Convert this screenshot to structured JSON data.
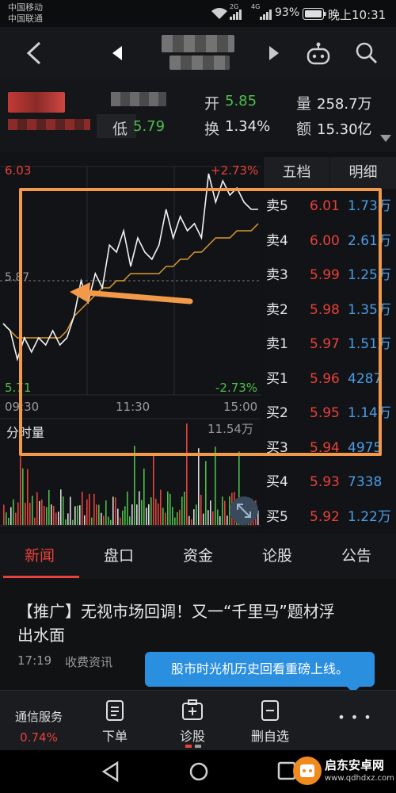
{
  "status_bar": {
    "carrier1": "中国移动",
    "carrier2": "中国联通",
    "net1": "2G",
    "net2": "4G",
    "battery": "93%",
    "time": "晚上10:31"
  },
  "nav": {
    "back_icon": "chevron-left-icon",
    "robot_icon": "robot-icon",
    "search_icon": "search-icon"
  },
  "quote": {
    "open_label": "开",
    "open_value": "5.85",
    "volume_label": "量",
    "volume_value": "258.7万",
    "low_label": "低",
    "low_value": "5.79",
    "turnover_label": "换",
    "turnover_value": "1.34%",
    "amount_label": "额",
    "amount_value": "15.30亿"
  },
  "chart": {
    "price_high": "6.03",
    "price_mid": "5.87",
    "price_low": "5.71",
    "pct_high": "+2.73%",
    "pct_low": "-2.73%",
    "time_start": "09:30",
    "time_mid": "11:30",
    "time_end": "15:00",
    "volume_label": "分时量",
    "volume_max": "11.54万"
  },
  "chart_data": {
    "type": "line",
    "title": "",
    "xlabel": "",
    "ylabel": "",
    "ylim": [
      5.71,
      6.03
    ],
    "x_ticks": [
      "09:30",
      "11:30",
      "15:00"
    ],
    "series": [
      {
        "values": [
          5.81,
          5.8,
          5.76,
          5.79,
          5.77,
          5.79,
          5.78,
          5.8,
          5.78,
          5.79,
          5.82,
          5.87,
          5.84,
          5.88,
          5.86,
          5.92,
          5.91,
          5.94,
          5.89,
          5.93,
          5.91,
          5.9,
          5.92,
          5.97,
          5.93,
          5.96,
          5.94,
          5.95,
          5.93,
          6.02,
          5.98,
          6.01,
          5.99,
          6.0,
          5.98,
          5.97,
          5.97
        ]
      },
      {
        "values": [
          5.81,
          5.8,
          5.79,
          5.79,
          5.79,
          5.79,
          5.79,
          5.79,
          5.79,
          5.8,
          5.82,
          5.83,
          5.84,
          5.85,
          5.86,
          5.86,
          5.87,
          5.87,
          5.88,
          5.88,
          5.88,
          5.88,
          5.88,
          5.89,
          5.89,
          5.9,
          5.9,
          5.91,
          5.91,
          5.92,
          5.93,
          5.93,
          5.93,
          5.94,
          5.94,
          5.94,
          5.95
        ]
      }
    ]
  },
  "order_book": {
    "tabs": [
      "五档",
      "明细"
    ],
    "rows": [
      {
        "label": "卖5",
        "price": "6.01",
        "vol": "1.73万"
      },
      {
        "label": "卖4",
        "price": "6.00",
        "vol": "2.61万"
      },
      {
        "label": "卖3",
        "price": "5.99",
        "vol": "1.25万"
      },
      {
        "label": "卖2",
        "price": "5.98",
        "vol": "1.35万"
      },
      {
        "label": "卖1",
        "price": "5.97",
        "vol": "1.51万"
      },
      {
        "label": "买1",
        "price": "5.96",
        "vol": "4287"
      },
      {
        "label": "买2",
        "price": "5.95",
        "vol": "1.14万"
      },
      {
        "label": "买3",
        "price": "5.94",
        "vol": "4975"
      },
      {
        "label": "买4",
        "price": "5.93",
        "vol": "7338"
      },
      {
        "label": "买5",
        "price": "5.92",
        "vol": "1.22万"
      }
    ]
  },
  "news_tabs": [
    "新闻",
    "盘口",
    "资金",
    "论股",
    "公告"
  ],
  "news": {
    "headline_line1": "【推广】无视市场回调！又一“千里马”题材浮",
    "headline_line2": "出水面",
    "time": "17:19",
    "source": "收费资讯"
  },
  "toast": "股市时光机历史回看重磅上线。",
  "bottom_nav": {
    "service_label": "通信服务",
    "service_pct": "0.74%",
    "order_label": "下单",
    "diagnose_label": "诊股",
    "remove_label": "删自选",
    "more_label": "• • •"
  },
  "watermark": {
    "line1": "启东安卓网",
    "line2": "www.qdhdxz.com"
  },
  "colors": {
    "up": "#e8413b",
    "down": "#4bbf4b",
    "accent": "#f2994a",
    "avg_line": "#d99a2b",
    "vol_blue": "#4a9de8"
  }
}
